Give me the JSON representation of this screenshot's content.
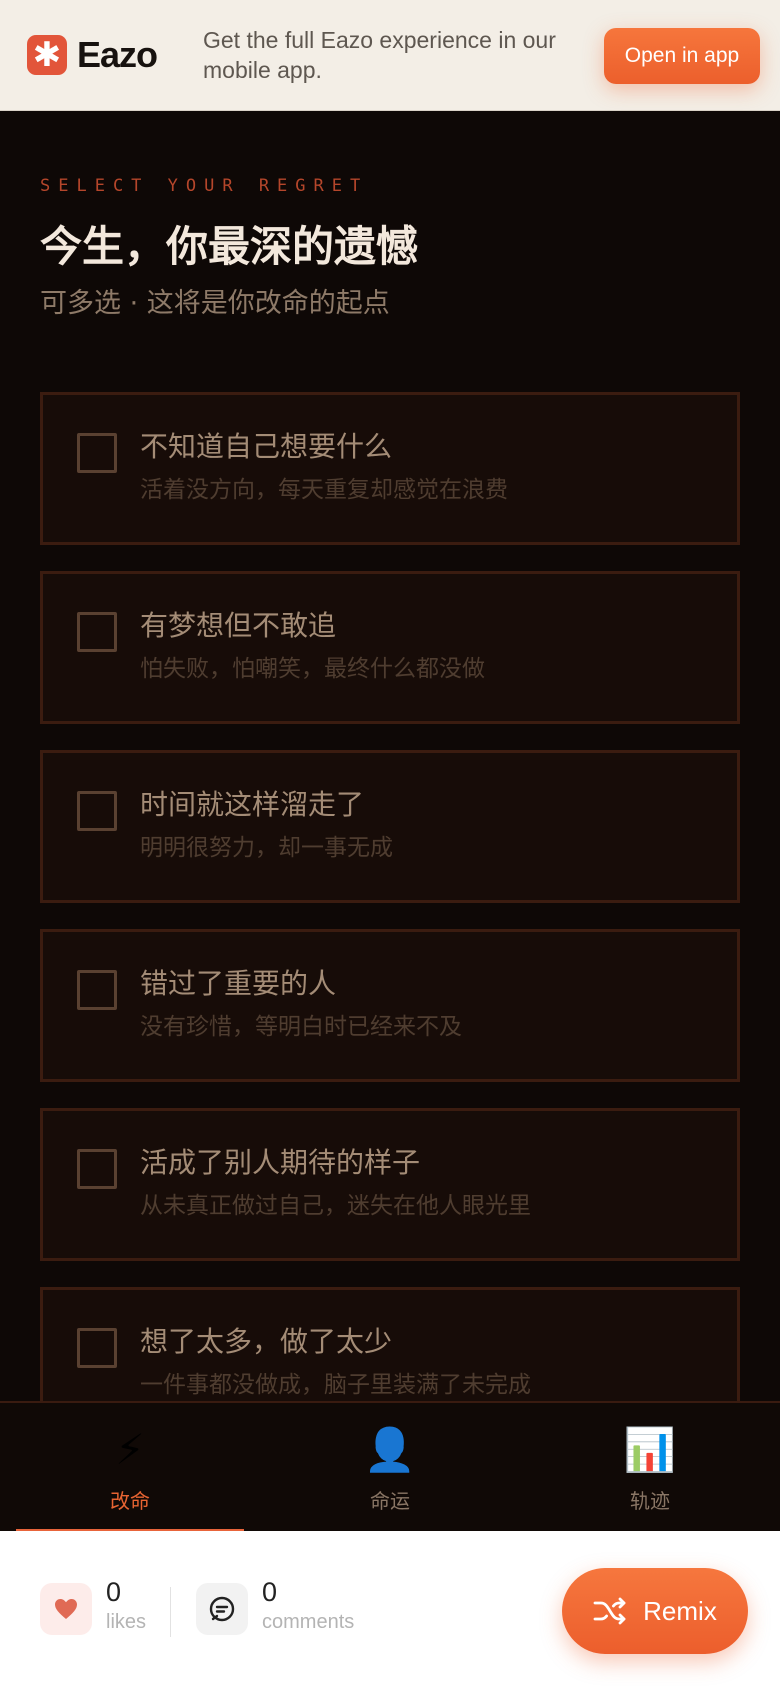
{
  "banner": {
    "brand": "Eazo",
    "message": "Get the full Eazo experience in our mobile app.",
    "open_label": "Open in app"
  },
  "header": {
    "eyebrow": "SELECT YOUR REGRET",
    "title": "今生，你最深的遗憾",
    "subtitle": "可多选 · 这将是你改命的起点"
  },
  "options": [
    {
      "title": "不知道自己想要什么",
      "desc": "活着没方向，每天重复却感觉在浪费",
      "checked": false
    },
    {
      "title": "有梦想但不敢追",
      "desc": "怕失败，怕嘲笑，最终什么都没做",
      "checked": false
    },
    {
      "title": "时间就这样溜走了",
      "desc": "明明很努力，却一事无成",
      "checked": false
    },
    {
      "title": "错过了重要的人",
      "desc": "没有珍惜，等明白时已经来不及",
      "checked": false
    },
    {
      "title": "活成了别人期待的样子",
      "desc": "从未真正做过自己，迷失在他人眼光里",
      "checked": false
    },
    {
      "title": "想了太多，做了太少",
      "desc": "一件事都没做成，脑子里装满了未完成",
      "checked": false
    }
  ],
  "nav": {
    "items": [
      {
        "icon": "⚡",
        "icon_name": "lightning-icon",
        "label": "改命",
        "active": true
      },
      {
        "icon": "👤",
        "icon_name": "person-icon",
        "label": "命运",
        "active": false
      },
      {
        "icon": "📊",
        "icon_name": "bar-chart-icon",
        "label": "轨迹",
        "active": false
      }
    ]
  },
  "footer": {
    "likes_count": "0",
    "likes_label": "likes",
    "comments_count": "0",
    "comments_label": "comments",
    "remix_label": "Remix"
  },
  "colors": {
    "accent": "#ec5f2c",
    "background": "#0e0806",
    "card_border": "#3b1c10"
  }
}
